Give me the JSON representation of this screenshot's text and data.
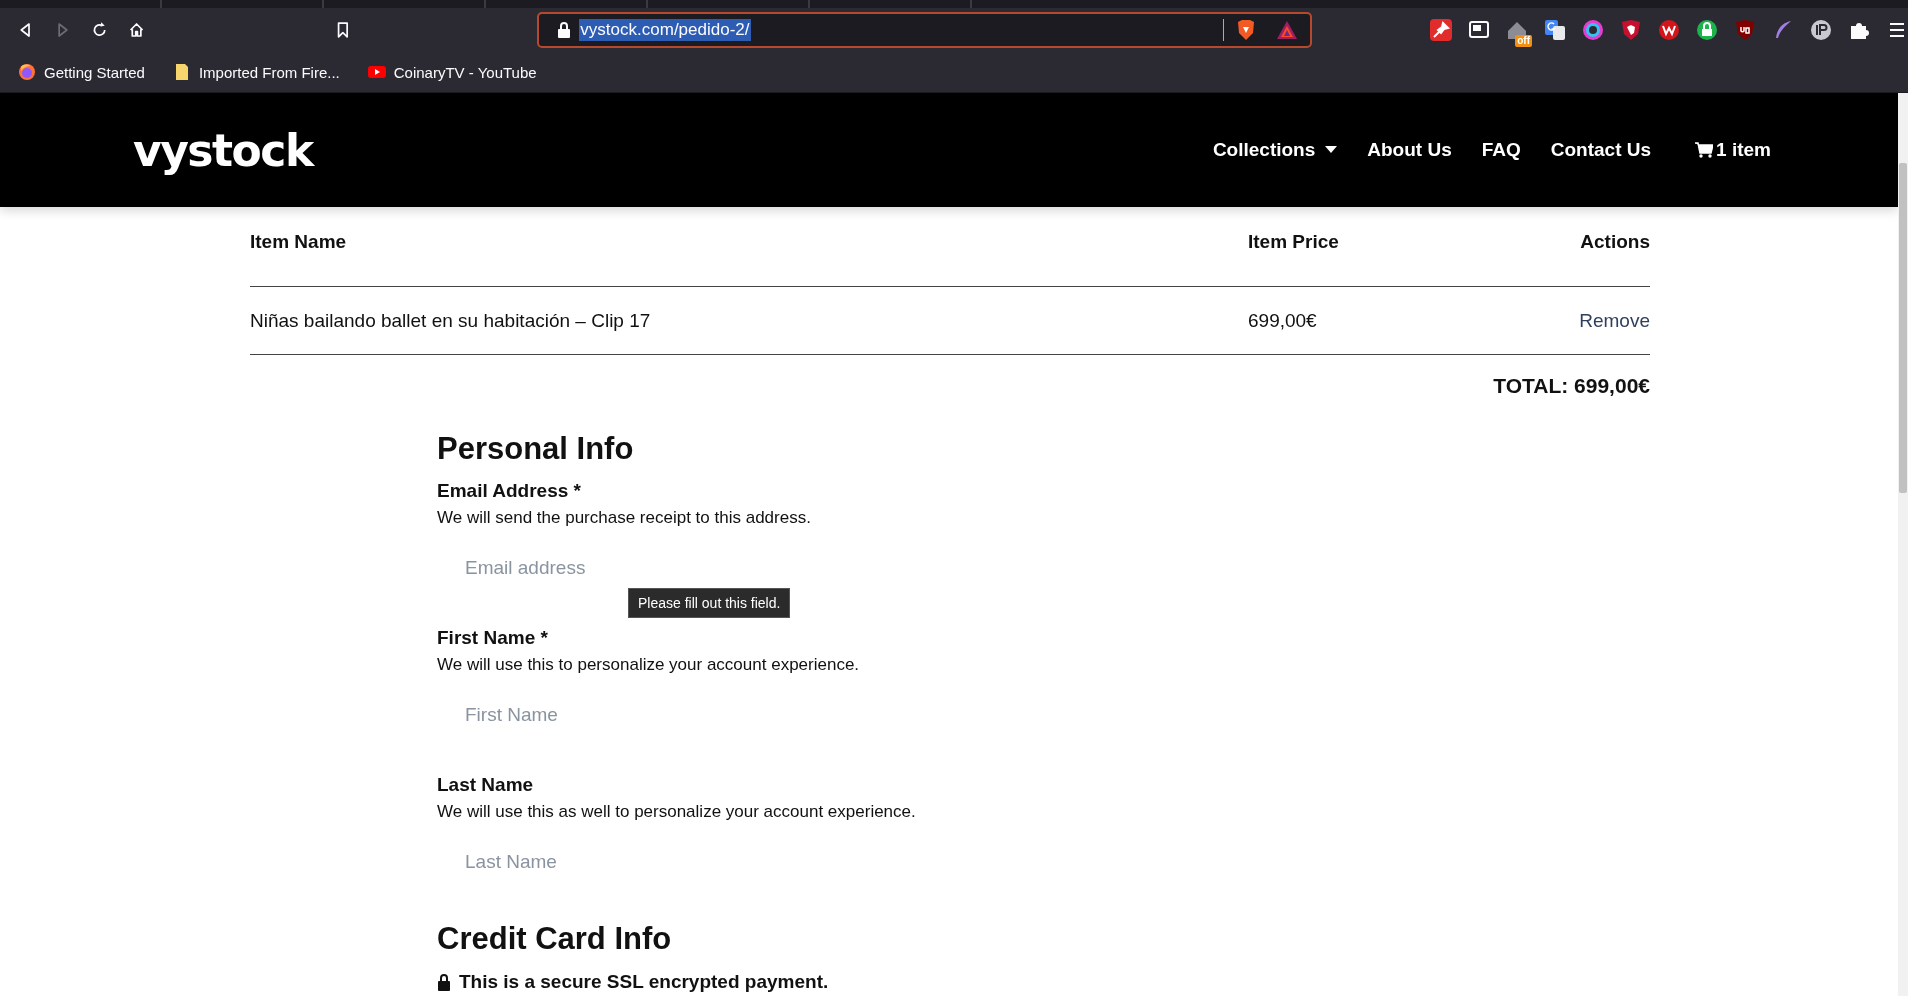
{
  "browser": {
    "forward_disabled": true,
    "url": "vystock.com/pedido-2/",
    "url_selected": true,
    "extension_badge": "off",
    "bookmarks": [
      {
        "label": "Getting Started",
        "kind": "firefox"
      },
      {
        "label": "Imported From Fire...",
        "kind": "folder"
      },
      {
        "label": "CoinaryTV - YouTube",
        "kind": "youtube"
      }
    ]
  },
  "site_header": {
    "logo": "vystock",
    "nav": [
      {
        "label": "Collections",
        "kind": "dropdown"
      },
      {
        "label": "About Us",
        "kind": "link"
      },
      {
        "label": "FAQ",
        "kind": "link"
      },
      {
        "label": "Contact Us",
        "kind": "link"
      },
      {
        "label": "1 item",
        "kind": "cart"
      }
    ]
  },
  "cart_table": {
    "columns": [
      "Item Name",
      "Item Price",
      "Actions"
    ],
    "rows": [
      {
        "item_name": "Niñas bailando ballet en su habitación – Clip 17",
        "item_price": "699,00€",
        "action": "Remove"
      }
    ],
    "total": "TOTAL: 699,00€"
  },
  "personal_info": {
    "title": "Personal Info",
    "fields": [
      {
        "label": "Email Address *",
        "help": "We will send the purchase receipt to this address.",
        "placeholder": "Email address",
        "validation_tooltip": "Please fill out this field."
      },
      {
        "label": "First Name *",
        "help": "We will use this to personalize your account experience.",
        "placeholder": "First Name"
      },
      {
        "label": "Last Name",
        "help": "We will use this as well to personalize your account experience.",
        "placeholder": "Last Name"
      }
    ]
  },
  "credit_card_info": {
    "title": "Credit Card Info",
    "secure_note": "This is a secure SSL encrypted payment."
  }
}
